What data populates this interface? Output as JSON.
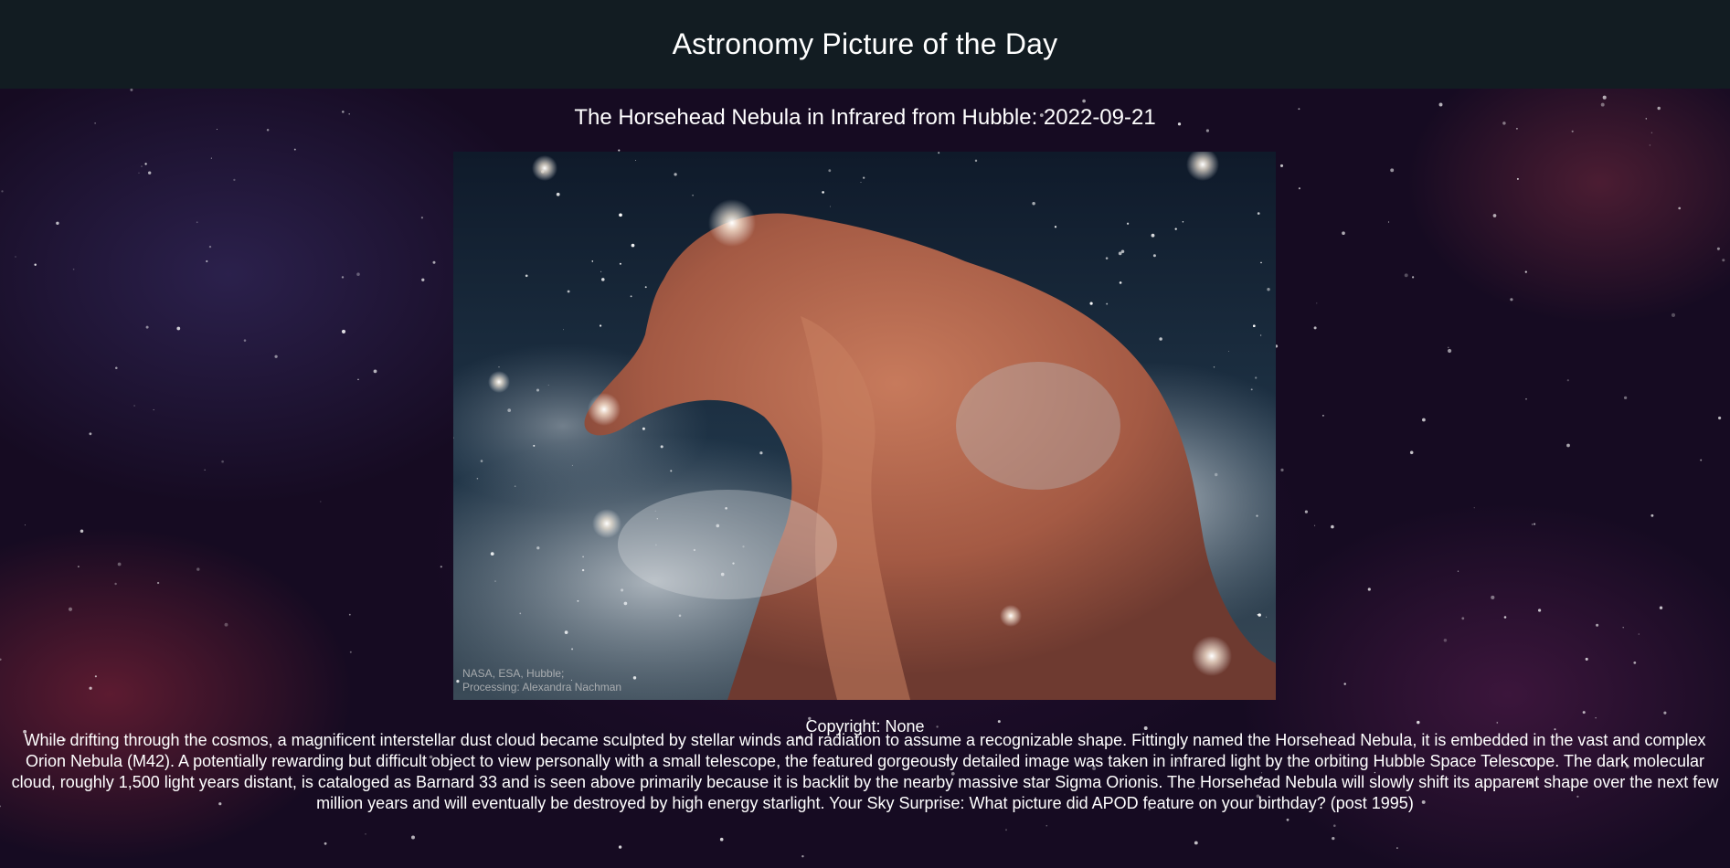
{
  "app": {
    "title": "Astronomy Picture of the Day"
  },
  "apod": {
    "title_line": "The Horsehead Nebula in Infrared from Hubble: 2022-09-21",
    "image_credit_line1": "NASA, ESA, Hubble;",
    "image_credit_line2": "Processing: Alexandra Nachman",
    "explanation": "While drifting through the cosmos, a magnificent interstellar dust cloud became sculpted by stellar winds and radiation to assume a recognizable shape. Fittingly named the Horsehead Nebula, it is embedded in the vast and complex Orion Nebula (M42). A potentially rewarding but difficult object to view personally with a small telescope, the featured gorgeously detailed image was taken in infrared light by the orbiting Hubble Space Telescope. The dark molecular cloud, roughly 1,500 light years distant, is cataloged as Barnard 33 and is seen above primarily because it is backlit by the nearby massive star Sigma Orionis. The Horsehead Nebula will slowly shift its apparent shape over the next few million years and will eventually be destroyed by high energy starlight. Your Sky Surprise: What picture did APOD feature on your birthday? (post 1995)",
    "copyright": "Copyright: None"
  },
  "colors": {
    "header_bg": "#121c22",
    "page_bg": "#160b22",
    "nebula": "#b8634a"
  },
  "icons": {
    "background": "starfield-background",
    "photo": "horsehead-nebula-image"
  }
}
